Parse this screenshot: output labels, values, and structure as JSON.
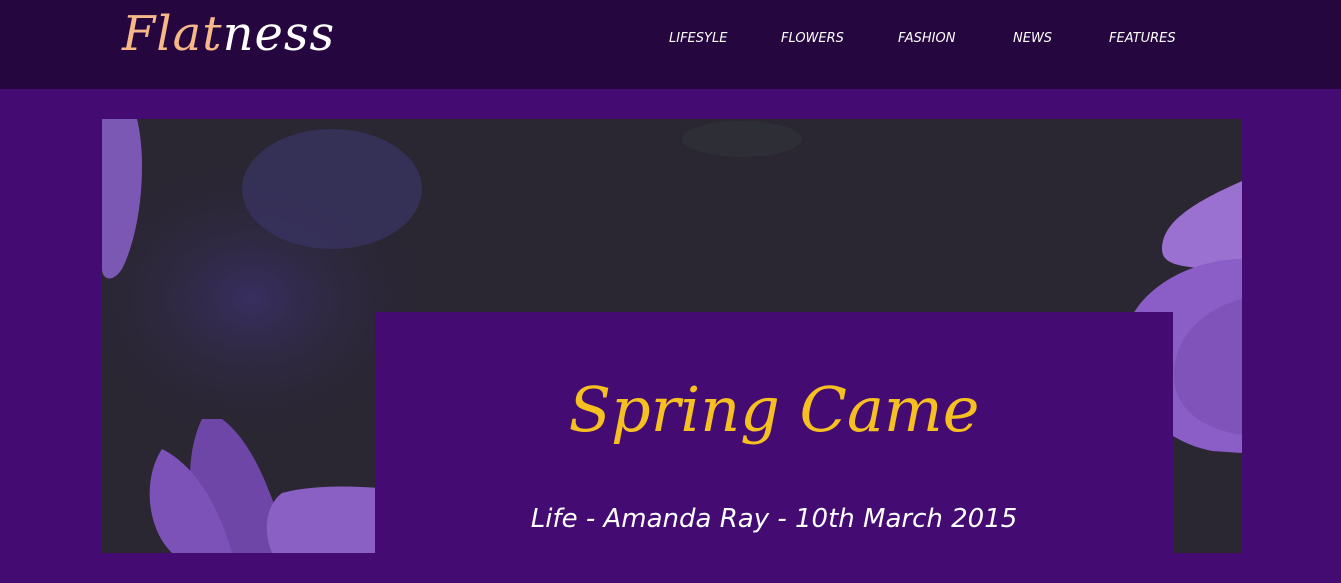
{
  "header": {
    "logo_part1": "Flat",
    "logo_part2": "ness",
    "colors": {
      "background": "#25063f",
      "logo_accent": "#f6b889"
    }
  },
  "nav": {
    "items": [
      {
        "label": "LIFESYLE"
      },
      {
        "label": "FLOWERS"
      },
      {
        "label": "FASHION"
      },
      {
        "label": "NEWS"
      },
      {
        "label": "FEATURES"
      }
    ]
  },
  "hero": {
    "title": "Spring Came",
    "meta": "Life - Amanda Ray - 10th March 2015",
    "image": "purple-violet-flowers",
    "colors": {
      "page": "#440b73",
      "card": "#440b73",
      "title": "#f5c020"
    }
  }
}
